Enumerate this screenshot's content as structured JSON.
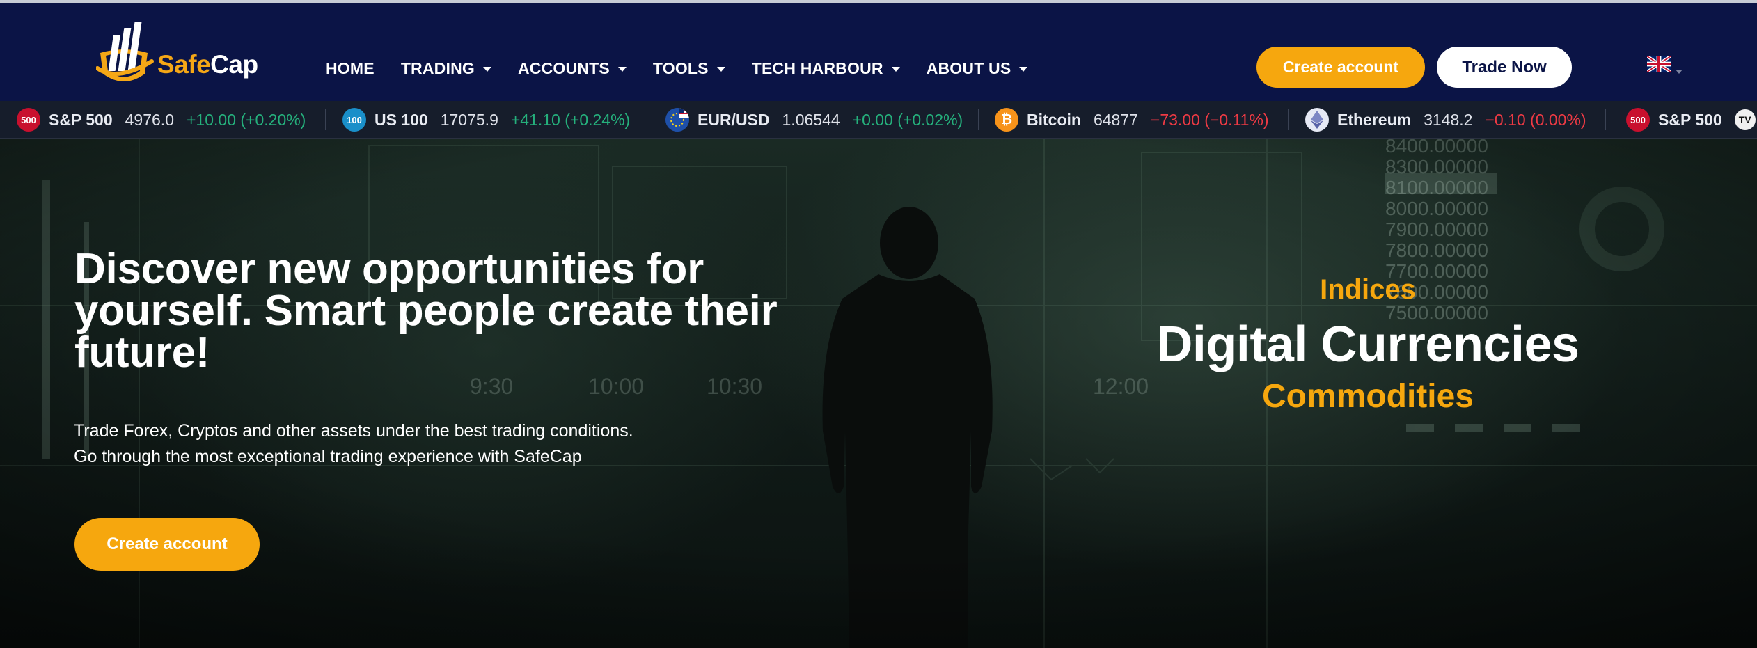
{
  "brand": {
    "name_part1": "Safe",
    "name_part2": "Cap"
  },
  "nav": [
    {
      "label": "HOME",
      "dropdown": false
    },
    {
      "label": "TRADING",
      "dropdown": true
    },
    {
      "label": "ACCOUNTS",
      "dropdown": true
    },
    {
      "label": "TOOLS",
      "dropdown": true
    },
    {
      "label": "TECH HARBOUR",
      "dropdown": true
    },
    {
      "label": "ABOUT US",
      "dropdown": true
    }
  ],
  "header_buttons": {
    "create_account": "Create account",
    "trade_now": "Trade Now"
  },
  "language": {
    "icon": "uk-flag-icon"
  },
  "ticker": [
    {
      "icon_text": "500",
      "icon_color": "#c8102e",
      "name": "S&P 500",
      "price": "4976.0",
      "change": "+10.00 (+0.20%)",
      "direction": "up"
    },
    {
      "icon_text": "100",
      "icon_color": "#1a8fc9",
      "name": "US 100",
      "price": "17075.9",
      "change": "+41.10 (+0.24%)",
      "direction": "up"
    },
    {
      "icon_text": "",
      "icon_color": "#1e4fa8",
      "name": "EUR/USD",
      "price": "1.06544",
      "change": "+0.00 (+0.02%)",
      "direction": "up"
    },
    {
      "icon_text": "₿",
      "icon_color": "#f7931a",
      "name": "Bitcoin",
      "price": "64877",
      "change": "−73.00 (−0.11%)",
      "direction": "down"
    },
    {
      "icon_text": "",
      "icon_color": "#e6e9f5",
      "name": "Ethereum",
      "price": "3148.2",
      "change": "−0.10 (0.00%)",
      "direction": "down"
    },
    {
      "icon_text": "500",
      "icon_color": "#c8102e",
      "name": "S&P 500",
      "price": "",
      "change": "",
      "direction": "up"
    }
  ],
  "hero": {
    "title": "Discover new opportunities for yourself. Smart people create their future!",
    "subtitle_line1": "Trade Forex, Cryptos and other assets under the best trading conditions.",
    "subtitle_line2": "Go through the most exceptional trading experience with SafeCap",
    "cta": "Create account",
    "rotating_words": [
      "Indices",
      "Digital Currencies",
      "Commodities"
    ],
    "bg_numbers": [
      "8400.00000",
      "8300.00000",
      "8100.00000",
      "8000.00000",
      "7900.00000",
      "7800.00000",
      "7700.00000",
      "7600.00000",
      "7500.00000"
    ],
    "bg_times": [
      "9:30",
      "10:00",
      "10:30",
      "12:00"
    ]
  },
  "colors": {
    "header_bg": "#0b1446",
    "accent": "#f6a70e",
    "ticker_bg": "#161d2b",
    "up": "#25b07c",
    "down": "#ee3a44"
  }
}
